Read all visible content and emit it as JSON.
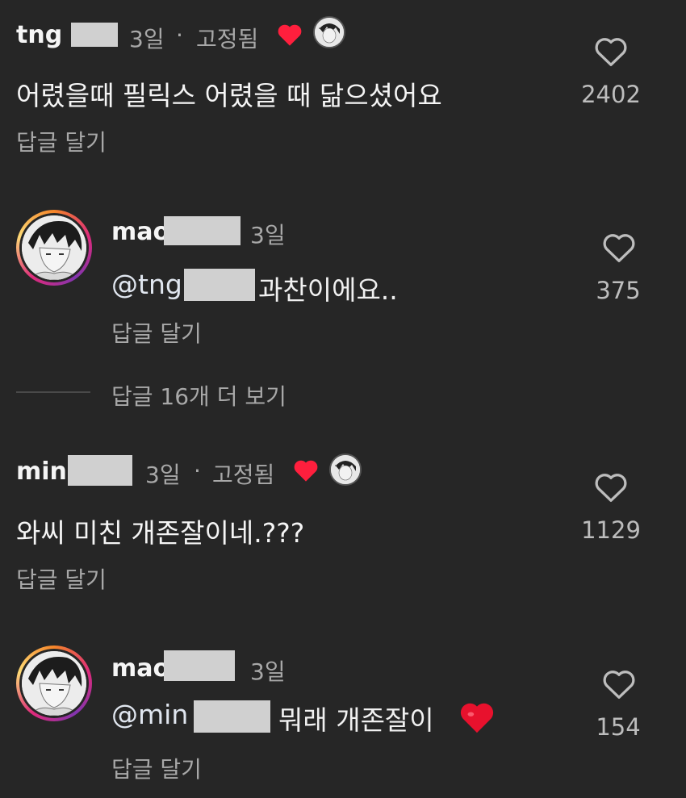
{
  "comments": [
    {
      "username": "tng",
      "time": "3일",
      "separator": "·",
      "pinned": "고정됨",
      "text": "어렸을때 필릭스 어렸을 때 닮으셨어요",
      "reply_action": "답글 달기",
      "like_count": "2402",
      "replies": [
        {
          "username": "mao",
          "time": "3일",
          "mention": "@tng",
          "text": "과찬이에요..",
          "reply_action": "답글 달기",
          "like_count": "375"
        }
      ],
      "more_replies": "답글 16개 더 보기"
    },
    {
      "username": "min",
      "time": "3일",
      "separator": "·",
      "pinned": "고정됨",
      "text": "와씨 미친 개존잘이네.???",
      "reply_action": "답글 달기",
      "like_count": "1129",
      "replies": [
        {
          "username": "mao",
          "time": "3일",
          "mention": "@min",
          "text": "뭐래 개존잘이",
          "reply_action": "답글 달기",
          "like_count": "154"
        }
      ]
    }
  ],
  "colors": {
    "background": "#262626",
    "heart_red": "#ff1f3d",
    "muted_text": "#a8a8a8"
  },
  "icons": [
    "heart-outline-icon",
    "heart-filled-icon",
    "avatar"
  ]
}
